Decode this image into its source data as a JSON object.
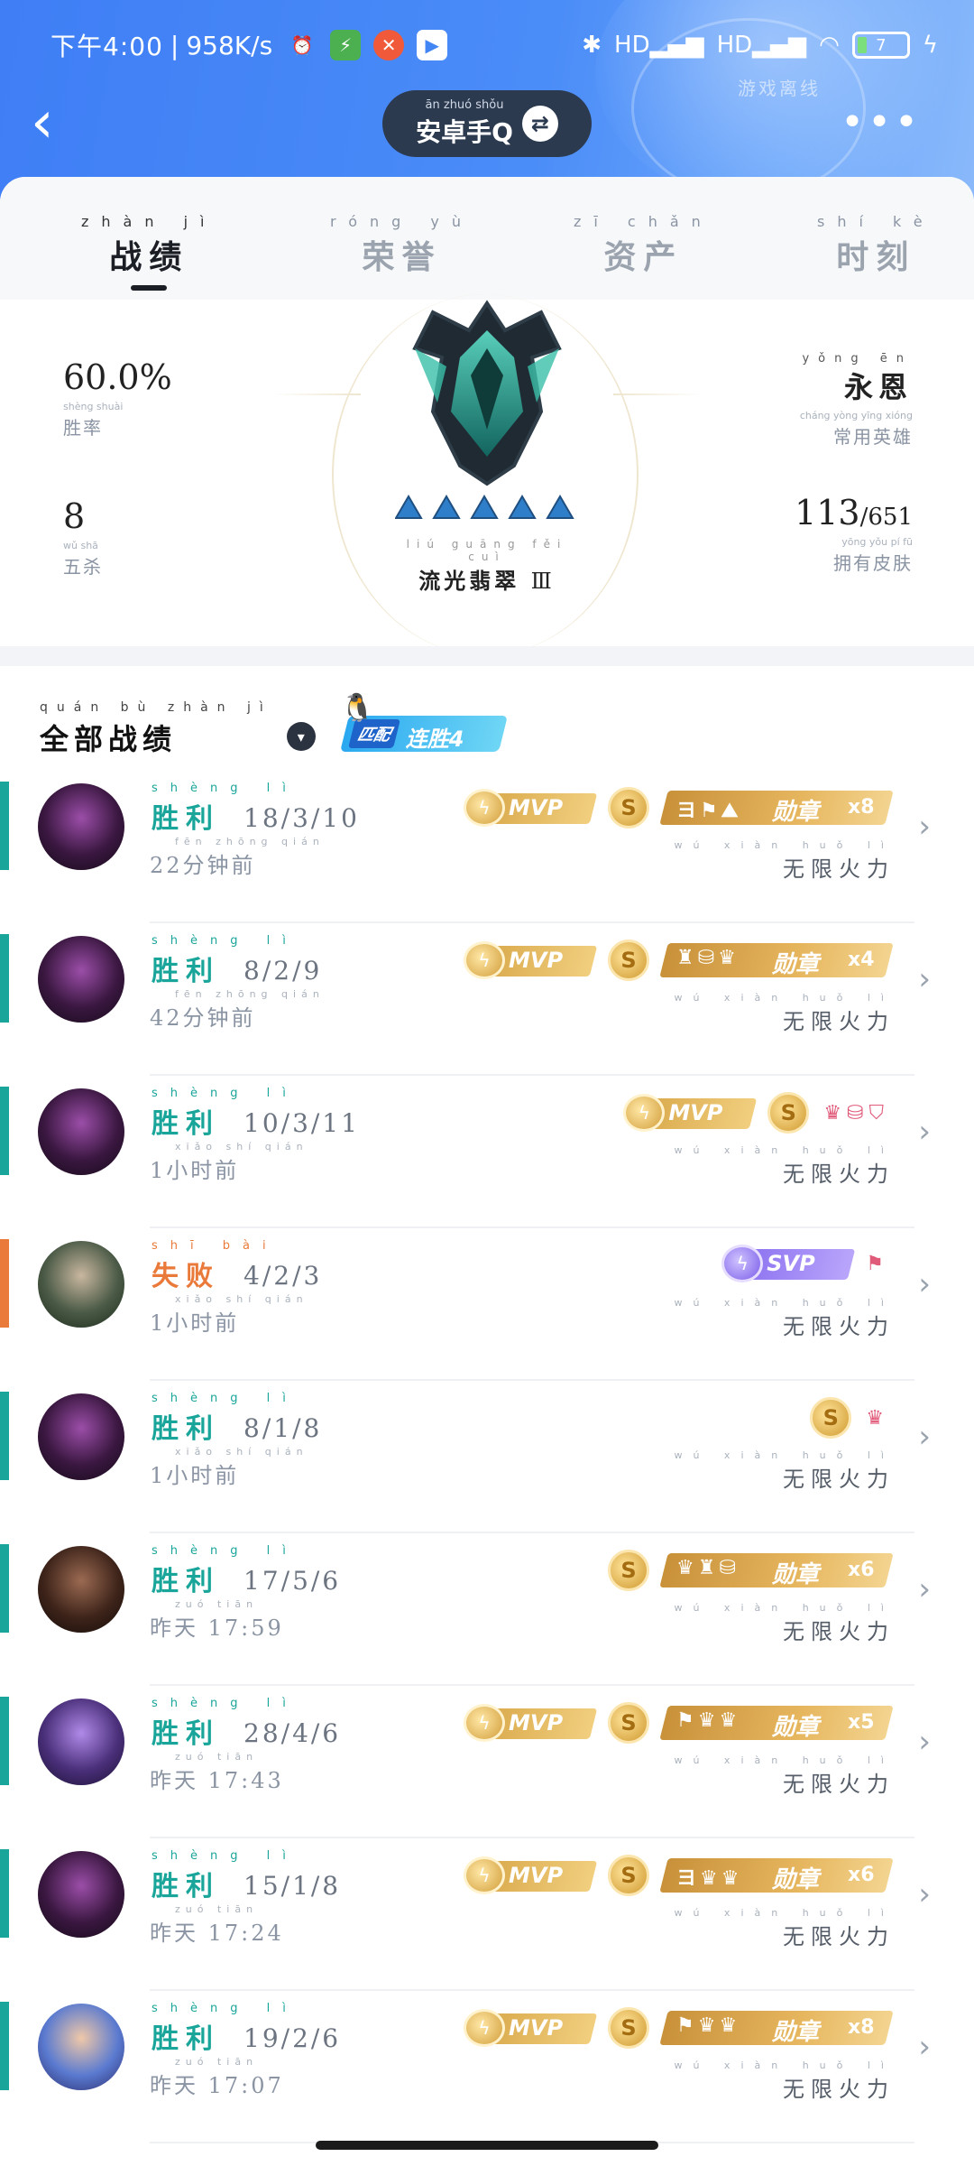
{
  "status_bar": {
    "time": "下午4:00",
    "speed": "958K/s",
    "icons": [
      "alarm-icon",
      "battery-saver-icon",
      "app-notification-icon",
      "play-store-icon"
    ],
    "right_icons": [
      "bluetooth-icon",
      "hd-signal-icon",
      "hd-signal-icon",
      "wifi-icon"
    ],
    "battery": "7"
  },
  "header": {
    "watermark": "游戏离线",
    "account_pinyin": "ān zhuó shǒu",
    "account": "安卓手Q",
    "colors": {
      "header_blue": "#4a8cf8",
      "pill": "#2c3a4f"
    }
  },
  "tabs": [
    {
      "pinyin": "zhàn jì",
      "label": "战绩",
      "active": true
    },
    {
      "pinyin": "róng yù",
      "label": "荣誉",
      "active": false
    },
    {
      "pinyin": "zī chǎn",
      "label": "资产",
      "active": false
    },
    {
      "pinyin": "shí kè",
      "label": "时刻",
      "active": false
    }
  ],
  "stats": {
    "win_rate": {
      "value": "60.0%",
      "pinyin": "shèng shuài",
      "label": "胜率"
    },
    "pentakills": {
      "value": "8",
      "pinyin": "wǔ shā",
      "label": "五杀"
    },
    "favorite_hero": {
      "value_pinyin": "yǒng ēn",
      "value": "永恩",
      "pinyin": "cháng yòng yīng xióng",
      "label": "常用英雄"
    },
    "skins": {
      "value": "113",
      "total": "/651",
      "pinyin": "yōng yǒu pí fū",
      "label": "拥有皮肤"
    }
  },
  "rank": {
    "pinyin": "liú guāng fěi cuì",
    "name": "流光翡翠",
    "tier": "Ⅲ",
    "pips": 5
  },
  "filter": {
    "pinyin": "quán bù zhàn jì",
    "label": "全部战绩",
    "mode": "匹配",
    "streak": "连胜4"
  },
  "matches": [
    {
      "result_py": "shèng lì",
      "result": "胜利",
      "win": true,
      "kda": "18/3/10",
      "time_py": "fēn zhōng qián",
      "time": "22分钟前",
      "mvp": "MVP",
      "s": true,
      "medal": {
        "icons": "ヨ⚑⛰",
        "label": "勋章",
        "count": "x8"
      },
      "mode_py": "wú xiàn huǒ lì",
      "mode": "无限火力",
      "avatar": "purple"
    },
    {
      "result_py": "shèng lì",
      "result": "胜利",
      "win": true,
      "kda": "8/2/9",
      "time_py": "fēn zhōng qián",
      "time": "42分钟前",
      "mvp": "MVP",
      "s": true,
      "medal": {
        "icons": "♜⛁♛",
        "label": "勋章",
        "count": "x4"
      },
      "mode_py": "wú xiàn huǒ lì",
      "mode": "无限火力",
      "avatar": "purple"
    },
    {
      "result_py": "shèng lì",
      "result": "胜利",
      "win": true,
      "kda": "10/3/11",
      "time_py": "xiǎo shí qián",
      "time": "1小时前",
      "mvp": "MVP",
      "s": true,
      "mini": "♛⛁⛉",
      "mode_py": "wú xiàn huǒ lì",
      "mode": "无限火力",
      "avatar": "purple"
    },
    {
      "result_py": "shī bài",
      "result": "失败",
      "win": false,
      "kda": "4/2/3",
      "time_py": "xiǎo shí qián",
      "time": "1小时前",
      "svp": "SVP",
      "mini": "⚑",
      "mode_py": "wú xiàn huǒ lì",
      "mode": "无限火力",
      "avatar": "bald"
    },
    {
      "result_py": "shèng lì",
      "result": "胜利",
      "win": true,
      "kda": "8/1/8",
      "time_py": "xiǎo shí qián",
      "time": "1小时前",
      "s": true,
      "mini": "♛",
      "mode_py": "wú xiàn huǒ lì",
      "mode": "无限火力",
      "avatar": "purple"
    },
    {
      "result_py": "shèng lì",
      "result": "胜利",
      "win": true,
      "kda": "17/5/6",
      "time_py": "zuó tiān",
      "time": "昨天 17:59",
      "s": true,
      "medal": {
        "icons": "♛♜⛁",
        "label": "勋章",
        "count": "x6"
      },
      "mode_py": "wú xiàn huǒ lì",
      "mode": "无限火力",
      "avatar": "dark"
    },
    {
      "result_py": "shèng lì",
      "result": "胜利",
      "win": true,
      "kda": "28/4/6",
      "time_py": "zuó tiān",
      "time": "昨天 17:43",
      "mvp": "MVP",
      "s": true,
      "medal": {
        "icons": "⚑♛♛",
        "label": "勋章",
        "count": "x5"
      },
      "mode_py": "wú xiàn huǒ lì",
      "mode": "无限火力",
      "avatar": "violet"
    },
    {
      "result_py": "shèng lì",
      "result": "胜利",
      "win": true,
      "kda": "15/1/8",
      "time_py": "zuó tiān",
      "time": "昨天 17:24",
      "mvp": "MVP",
      "s": true,
      "medal": {
        "icons": "ヨ♛♛",
        "label": "勋章",
        "count": "x6"
      },
      "mode_py": "wú xiàn huǒ lì",
      "mode": "无限火力",
      "avatar": "purple"
    },
    {
      "result_py": "shèng lì",
      "result": "胜利",
      "win": true,
      "kda": "19/2/6",
      "time_py": "zuó tiān",
      "time": "昨天 17:07",
      "mvp": "MVP",
      "s": true,
      "medal": {
        "icons": "⚑♛♛",
        "label": "勋章",
        "count": "x8"
      },
      "mode_py": "wú xiàn huǒ lì",
      "mode": "无限火力",
      "avatar": "blue"
    }
  ],
  "colors": {
    "win": "#1aa59a",
    "loss": "#ea7a3a",
    "gold": "#d9a84a"
  }
}
